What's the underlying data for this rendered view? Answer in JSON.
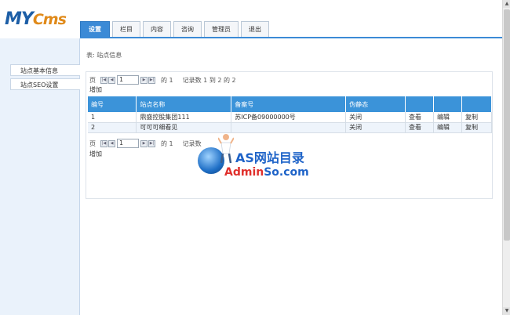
{
  "logo": {
    "my": "MY",
    "cms": "Cms"
  },
  "tabs": [
    "设置",
    "栏目",
    "内容",
    "咨询",
    "管理员",
    "退出"
  ],
  "sidebar": {
    "items": [
      "站点基本信息",
      "站点SEO设置"
    ]
  },
  "main": {
    "breadcrumb": "表: 站点信息",
    "pager_top": {
      "prefix": "页",
      "page_value": "1",
      "of": "的 1",
      "records": "记录数 1 到 2 的 2"
    },
    "add_top": "增加",
    "table": {
      "headers": [
        "编号",
        "站点名称",
        "备案号",
        "伪静态",
        "",
        "",
        ""
      ],
      "rows": [
        [
          "1",
          "鼎盛控股集团111",
          "苏ICP备09000000号",
          "关闭",
          "查看",
          "编辑",
          "复制"
        ],
        [
          "2",
          "可可可细看见",
          "",
          "关闭",
          "查看",
          "编辑",
          "复制"
        ]
      ]
    },
    "pager_bottom": {
      "prefix": "页",
      "page_value": "1",
      "of": "的 1",
      "records": "记录数"
    },
    "add_bottom": "增加"
  },
  "watermark": {
    "title": "AS网站目录",
    "sub_a": "Admin",
    "sub_b": "So.com"
  },
  "colors": {
    "accent": "#3b8ad6",
    "header_row": "#3b93d9",
    "sidebar_bg": "#eaf2fb"
  }
}
